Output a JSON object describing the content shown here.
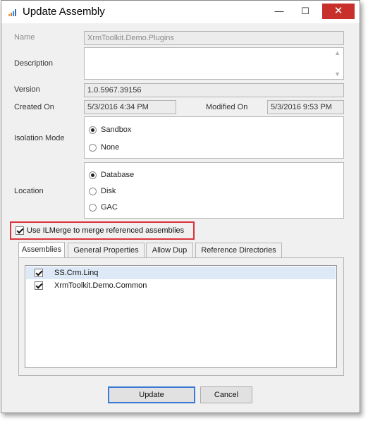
{
  "window": {
    "title": "Update Assembly"
  },
  "titlebar": {
    "minimize": "—",
    "maximize": "☐",
    "close": "✕"
  },
  "form": {
    "name_label": "Name",
    "name_value": "XrmToolkit.Demo.Plugins",
    "description_label": "Description",
    "description_value": "",
    "version_label": "Version",
    "version_value": "1.0.5967.39156",
    "created_label": "Created On",
    "created_value": "5/3/2016 4:34 PM",
    "modified_label": "Modified On",
    "modified_value": "5/3/2016 9:53 PM",
    "isolation_label": "Isolation Mode",
    "isolation_options": [
      "Sandbox",
      "None"
    ],
    "isolation_selected": "Sandbox",
    "location_label": "Location",
    "location_options": [
      "Database",
      "Disk",
      "GAC"
    ],
    "location_selected": "Database",
    "ilmerge_label": "Use ILMerge to merge referenced assemblies",
    "ilmerge_checked": true
  },
  "tabs": [
    "Assemblies",
    "General Properties",
    "Allow Dup",
    "Reference Directories"
  ],
  "active_tab": "Assemblies",
  "assemblies": [
    {
      "name": "SS.Crm.Linq",
      "checked": true,
      "selected": true
    },
    {
      "name": "XrmToolkit.Demo.Common",
      "checked": true,
      "selected": false
    }
  ],
  "buttons": {
    "update": "Update",
    "cancel": "Cancel"
  },
  "colors": {
    "highlight_border": "#d9343a",
    "close_button": "#c7302b",
    "primary_border": "#3a7bd5"
  }
}
